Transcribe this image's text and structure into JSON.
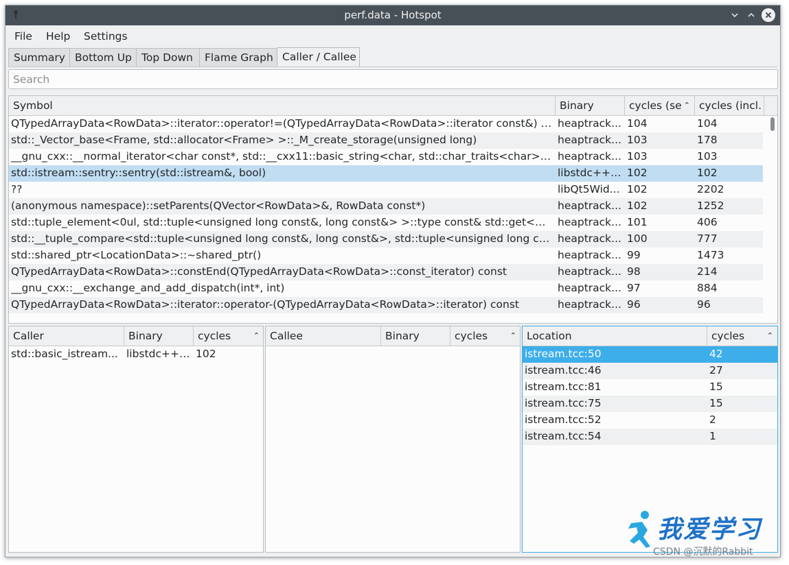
{
  "window": {
    "title": "perf.data - Hotspot"
  },
  "menu": [
    "File",
    "Help",
    "Settings"
  ],
  "tabs": [
    "Summary",
    "Bottom Up",
    "Top Down",
    "Flame Graph",
    "Caller / Callee"
  ],
  "active_tab": "Caller / Callee",
  "search": {
    "placeholder": "Search",
    "value": ""
  },
  "symbols_table": {
    "headers": {
      "symbol": "Symbol",
      "binary": "Binary",
      "self": "cycles (se",
      "incl": "cycles (incl."
    },
    "sorted_column": "self",
    "rows": [
      {
        "symbol": "QTypedArrayData<RowData>::iterator::operator!=(QTypedArrayData<RowData>::iterator const&) co...",
        "binary": "heaptrack...",
        "self": "104",
        "incl": "104"
      },
      {
        "symbol": "std::_Vector_base<Frame, std::allocator<Frame> >::_M_create_storage(unsigned long)",
        "binary": "heaptrack...",
        "self": "103",
        "incl": "178"
      },
      {
        "symbol": "__gnu_cxx::__normal_iterator<char const*, std::__cxx11::basic_string<char, std::char_traits<char>, st...",
        "binary": "heaptrack...",
        "self": "103",
        "incl": "103"
      },
      {
        "symbol": "std::istream::sentry::sentry(std::istream&, bool)",
        "binary": "libstdc++....",
        "self": "102",
        "incl": "102",
        "selected": true
      },
      {
        "symbol": "??",
        "binary": "libQt5Wid...",
        "self": "102",
        "incl": "2202"
      },
      {
        "symbol": "(anonymous namespace)::setParents(QVector<RowData>&, RowData const*)",
        "binary": "heaptrack...",
        "self": "102",
        "incl": "1252"
      },
      {
        "symbol": "std::tuple_element<0ul, std::tuple<unsigned long const&, long const&> >::type const& std::get<0ul, ...",
        "binary": "heaptrack...",
        "self": "101",
        "incl": "406"
      },
      {
        "symbol": "std::__tuple_compare<std::tuple<unsigned long const&, long const&>, std::tuple<unsigned long cons...",
        "binary": "heaptrack...",
        "self": "100",
        "incl": "777"
      },
      {
        "symbol": "std::shared_ptr<LocationData>::~shared_ptr()",
        "binary": "heaptrack...",
        "self": "99",
        "incl": "1473"
      },
      {
        "symbol": "QTypedArrayData<RowData>::constEnd(QTypedArrayData<RowData>::const_iterator) const",
        "binary": "heaptrack...",
        "self": "98",
        "incl": "214"
      },
      {
        "symbol": "__gnu_cxx::__exchange_and_add_dispatch(int*, int)",
        "binary": "heaptrack...",
        "self": "97",
        "incl": "884"
      },
      {
        "symbol": "QTypedArrayData<RowData>::iterator::operator-(QTypedArrayData<RowData>::iterator) const",
        "binary": "heaptrack...",
        "self": "96",
        "incl": "96"
      }
    ]
  },
  "caller_table": {
    "headers": {
      "name": "Caller",
      "binary": "Binary",
      "cycles": "cycles"
    },
    "rows": [
      {
        "name": "std::basic_istream...",
        "binary": "libstdc++....",
        "cycles": "102"
      }
    ]
  },
  "callee_table": {
    "headers": {
      "name": "Callee",
      "binary": "Binary",
      "cycles": "cycles"
    },
    "rows": []
  },
  "location_table": {
    "headers": {
      "location": "Location",
      "cycles": "cycles"
    },
    "rows": [
      {
        "location": "istream.tcc:50",
        "cycles": "42",
        "selected": true
      },
      {
        "location": "istream.tcc:46",
        "cycles": "27"
      },
      {
        "location": "istream.tcc:81",
        "cycles": "15"
      },
      {
        "location": "istream.tcc:75",
        "cycles": "15"
      },
      {
        "location": "istream.tcc:52",
        "cycles": "2"
      },
      {
        "location": "istream.tcc:54",
        "cycles": "1"
      }
    ]
  },
  "watermark": {
    "logo_text": "我爱学习",
    "text": "CSDN @沉默的Rabbit"
  },
  "colors": {
    "titlebar": "#475057",
    "selection": "#3daee9",
    "selection_inactive": "#c1ddf2",
    "window": "#eff0f1",
    "base": "#fcfcfc"
  }
}
